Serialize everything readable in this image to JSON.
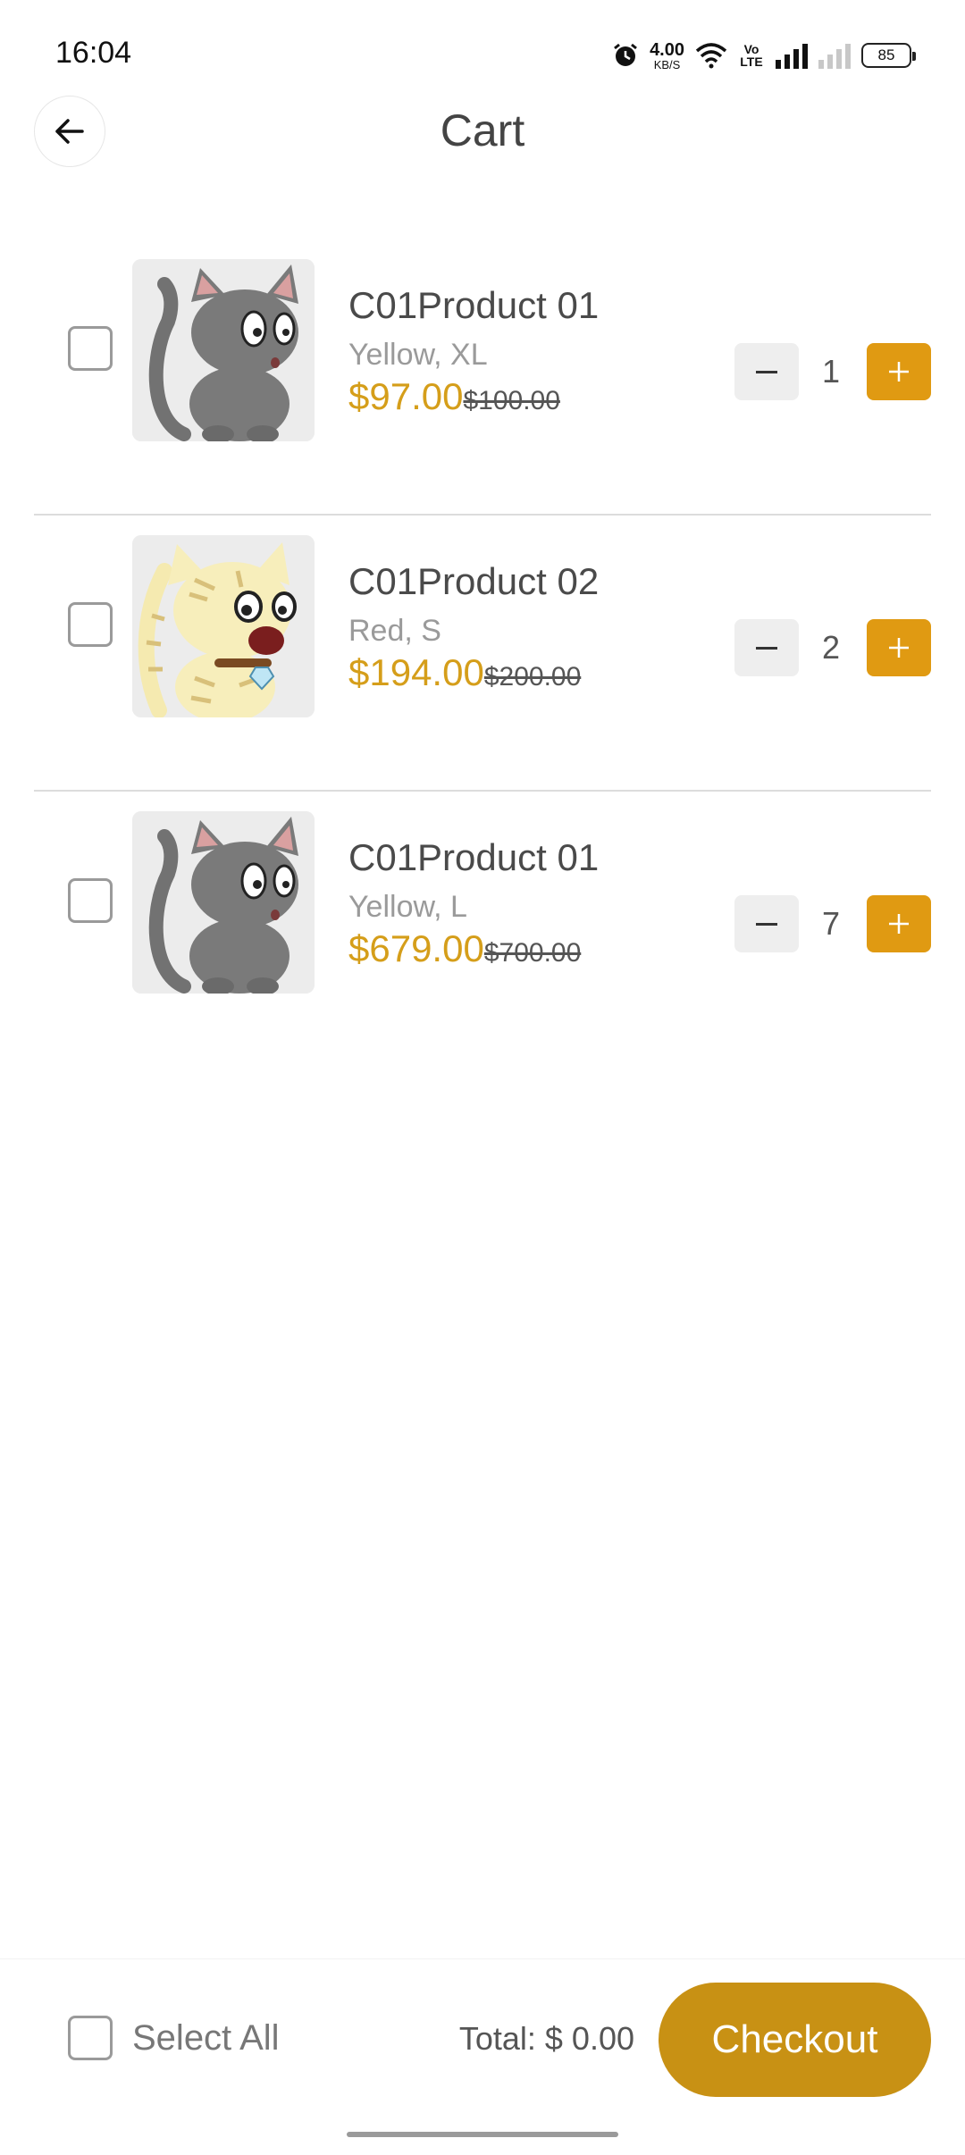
{
  "status_bar": {
    "time": "16:04",
    "net_speed": "4.00",
    "net_unit": "KB/S",
    "volte": "Vo LTE",
    "battery": "85",
    "icons": [
      "alarm-icon",
      "wifi-icon",
      "signal-icon",
      "signal-off-icon",
      "battery-icon"
    ]
  },
  "header": {
    "title": "Cart",
    "back_icon": "arrow-left-icon"
  },
  "items": [
    {
      "name": "C01Product 01",
      "variant": "Yellow, XL",
      "price": "$97.00",
      "original_price": "$100.00",
      "quantity": "1",
      "thumb": "gray-cat"
    },
    {
      "name": "C01Product 02",
      "variant": "Red, S",
      "price": "$194.00",
      "original_price": "$200.00",
      "quantity": "2",
      "thumb": "cream-tabby-cat"
    },
    {
      "name": "C01Product 01",
      "variant": "Yellow, L",
      "price": "$679.00",
      "original_price": "$700.00",
      "quantity": "7",
      "thumb": "gray-cat"
    }
  ],
  "footer": {
    "select_all_label": "Select All",
    "total_label": "Total: $ 0.00",
    "checkout_label": "Checkout"
  },
  "colors": {
    "accent": "#e09a12",
    "price": "#d59e1a",
    "checkout": "#c89114"
  }
}
